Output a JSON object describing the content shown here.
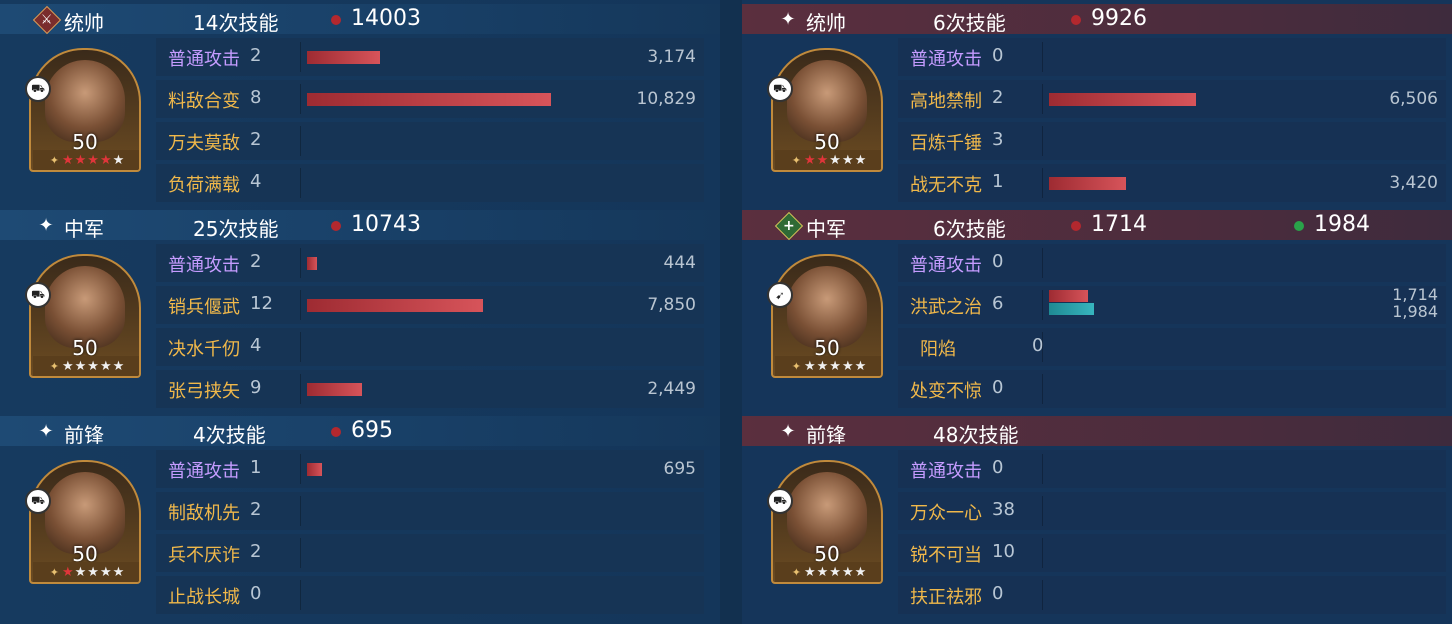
{
  "left": {
    "sections": [
      {
        "role": "统帅",
        "role_icon": "sword-icon",
        "count": "14次技能",
        "damage": "14003",
        "level": "50",
        "stars": [
          "red",
          "red",
          "red",
          "red",
          "white"
        ],
        "troop_icon": "tank-icon",
        "rows": [
          {
            "skill": "普通攻击",
            "basic": true,
            "num": "2",
            "bar_fraction": 0.066,
            "value": "3,174"
          },
          {
            "skill": "料敌合变",
            "basic": false,
            "num": "8",
            "bar_fraction": 0.222,
            "value": "10,829"
          },
          {
            "skill": "万夫莫敌",
            "basic": false,
            "num": "2",
            "bar_fraction": 0,
            "value": ""
          },
          {
            "skill": "负荷满载",
            "basic": false,
            "num": "4",
            "bar_fraction": 0,
            "value": ""
          }
        ]
      },
      {
        "role": "中军",
        "role_icon": "sparkle-icon",
        "count": "25次技能",
        "damage": "10743",
        "level": "50",
        "stars": [
          "white",
          "white",
          "white",
          "white",
          "white"
        ],
        "troop_icon": "truck-icon",
        "rows": [
          {
            "skill": "普通攻击",
            "basic": true,
            "num": "2",
            "bar_fraction": 0.009,
            "value": "444"
          },
          {
            "skill": "销兵偃武",
            "basic": false,
            "num": "12",
            "bar_fraction": 0.16,
            "value": "7,850"
          },
          {
            "skill": "决水千仞",
            "basic": false,
            "num": "4",
            "bar_fraction": 0,
            "value": ""
          },
          {
            "skill": "张弓挟矢",
            "basic": false,
            "num": "9",
            "bar_fraction": 0.05,
            "value": "2,449"
          }
        ]
      },
      {
        "role": "前锋",
        "role_icon": "sparkle-icon",
        "count": "4次技能",
        "damage": "695",
        "level": "50",
        "stars": [
          "red",
          "white",
          "white",
          "white",
          "white"
        ],
        "troop_icon": "tank-icon",
        "rows": [
          {
            "skill": "普通攻击",
            "basic": true,
            "num": "1",
            "bar_fraction": 0.014,
            "value": "695"
          },
          {
            "skill": "制敌机先",
            "basic": false,
            "num": "2",
            "bar_fraction": 0,
            "value": ""
          },
          {
            "skill": "兵不厌诈",
            "basic": false,
            "num": "2",
            "bar_fraction": 0,
            "value": ""
          },
          {
            "skill": "止战长城",
            "basic": false,
            "num": "0",
            "bar_fraction": 0,
            "value": ""
          }
        ]
      }
    ]
  },
  "right": {
    "sections": [
      {
        "role": "统帅",
        "role_icon": "sparkle-icon",
        "count": "6次技能",
        "damage": "9926",
        "level": "50",
        "stars": [
          "red",
          "red",
          "white",
          "white",
          "white"
        ],
        "troop_icon": "tank-icon",
        "rows": [
          {
            "skill": "普通攻击",
            "basic": true,
            "num": "0",
            "bar_fraction": 0,
            "value": ""
          },
          {
            "skill": "高地禁制",
            "basic": false,
            "num": "2",
            "bar_fraction": 0.134,
            "value": "6,506"
          },
          {
            "skill": "百炼千锤",
            "basic": false,
            "num": "3",
            "bar_fraction": 0,
            "value": ""
          },
          {
            "skill": "战无不克",
            "basic": false,
            "num": "1",
            "bar_fraction": 0.07,
            "value": "3,420"
          }
        ]
      },
      {
        "role": "中军",
        "role_icon": "heal-icon",
        "count": "6次技能",
        "damage": "1714",
        "heal": "1984",
        "level": "50",
        "stars": [
          "white",
          "white",
          "white",
          "white",
          "white"
        ],
        "troop_icon": "spear-icon",
        "rows": [
          {
            "skill": "普通攻击",
            "basic": true,
            "num": "0",
            "bar_fraction": 0,
            "value": ""
          },
          {
            "skill": "洪武之治",
            "basic": false,
            "num": "6",
            "bar_fraction": 0.035,
            "bar2_fraction": 0.041,
            "value": "1,714",
            "value2": "1,984"
          },
          {
            "skill": "阳焰",
            "basic": false,
            "num": "0",
            "bar_fraction": 0,
            "value": ""
          },
          {
            "skill": "处变不惊",
            "basic": false,
            "num": "0",
            "bar_fraction": 0,
            "value": ""
          }
        ]
      },
      {
        "role": "前锋",
        "role_icon": "sparkle-icon",
        "count": "48次技能",
        "damage": "",
        "level": "50",
        "stars": [
          "white",
          "white",
          "white",
          "white",
          "white"
        ],
        "troop_icon": "tank-icon",
        "rows": [
          {
            "skill": "普通攻击",
            "basic": true,
            "num": "0",
            "bar_fraction": 0,
            "value": ""
          },
          {
            "skill": "万众一心",
            "basic": false,
            "num": "38",
            "bar_fraction": 0,
            "value": ""
          },
          {
            "skill": "锐不可当",
            "basic": false,
            "num": "10",
            "bar_fraction": 0,
            "value": ""
          },
          {
            "skill": "扶正祛邪",
            "basic": false,
            "num": "0",
            "bar_fraction": 0,
            "value": ""
          }
        ]
      }
    ]
  },
  "colors": {
    "basic_skill": "#c59cff",
    "skill": "#f0b84a",
    "damage_bar": "#c4434a",
    "heal_bar": "#2aa5ae",
    "damage_dot": "#b3282e",
    "heal_dot": "#2aa34a"
  }
}
